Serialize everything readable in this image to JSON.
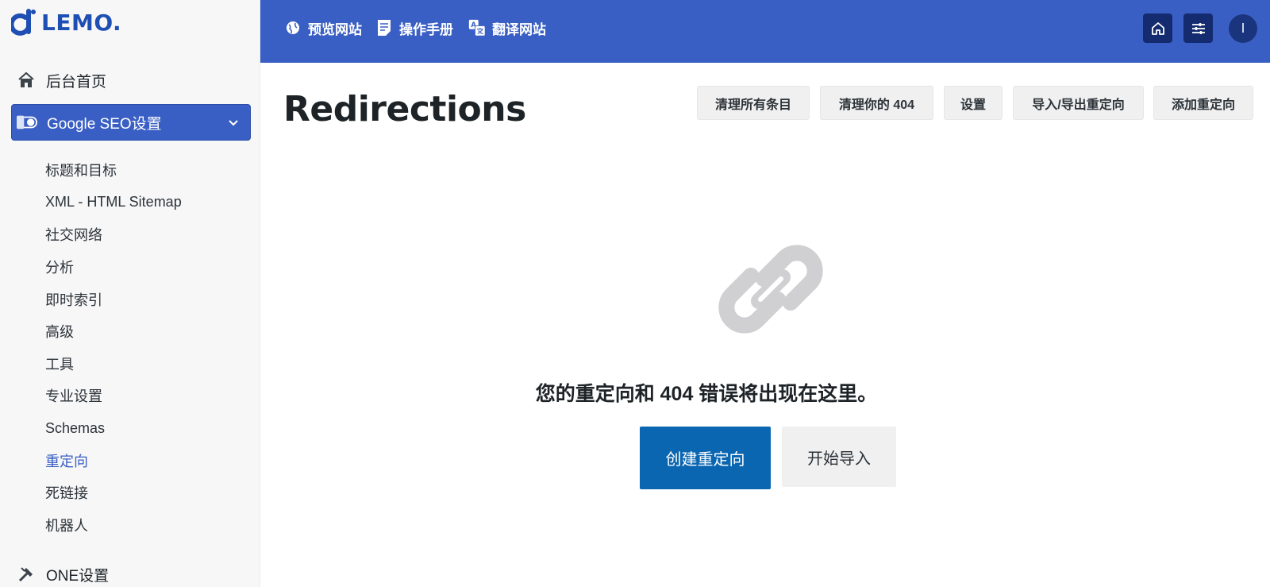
{
  "brand": {
    "logo_text": "LEMO.",
    "color": "#1f4fb3"
  },
  "sidebar": {
    "home": {
      "label": "后台首页",
      "icon": "home-icon"
    },
    "seo": {
      "label": "Google SEO设置",
      "icon": "toggle-icon",
      "expanded": true
    },
    "items": [
      {
        "label": "标题和目标"
      },
      {
        "label": "XML - HTML Sitemap"
      },
      {
        "label": "社交网络"
      },
      {
        "label": "分析"
      },
      {
        "label": "即时索引"
      },
      {
        "label": "高级"
      },
      {
        "label": "工具"
      },
      {
        "label": "专业设置"
      },
      {
        "label": "Schemas"
      },
      {
        "label": "重定向",
        "active": true
      },
      {
        "label": "死链接"
      },
      {
        "label": "机器人"
      }
    ],
    "one": {
      "label": "ONE设置",
      "icon": "tools-icon"
    }
  },
  "topbar": {
    "color": "#3a5fc4",
    "links": [
      {
        "label": "预览网站",
        "icon": "globe-icon"
      },
      {
        "label": "操作手册",
        "icon": "document-icon"
      },
      {
        "label": "翻译网站",
        "icon": "translate-icon"
      }
    ],
    "avatar": "l"
  },
  "main": {
    "title": "Redirections",
    "actions": [
      "清理所有条目",
      "清理你的 404",
      "设置",
      "导入/导出重定向",
      "添加重定向"
    ],
    "empty_message": "您的重定向和 404 错误将出现在这里。",
    "primary_button": "创建重定向",
    "secondary_button": "开始导入",
    "primary_color": "#0b66b1"
  }
}
